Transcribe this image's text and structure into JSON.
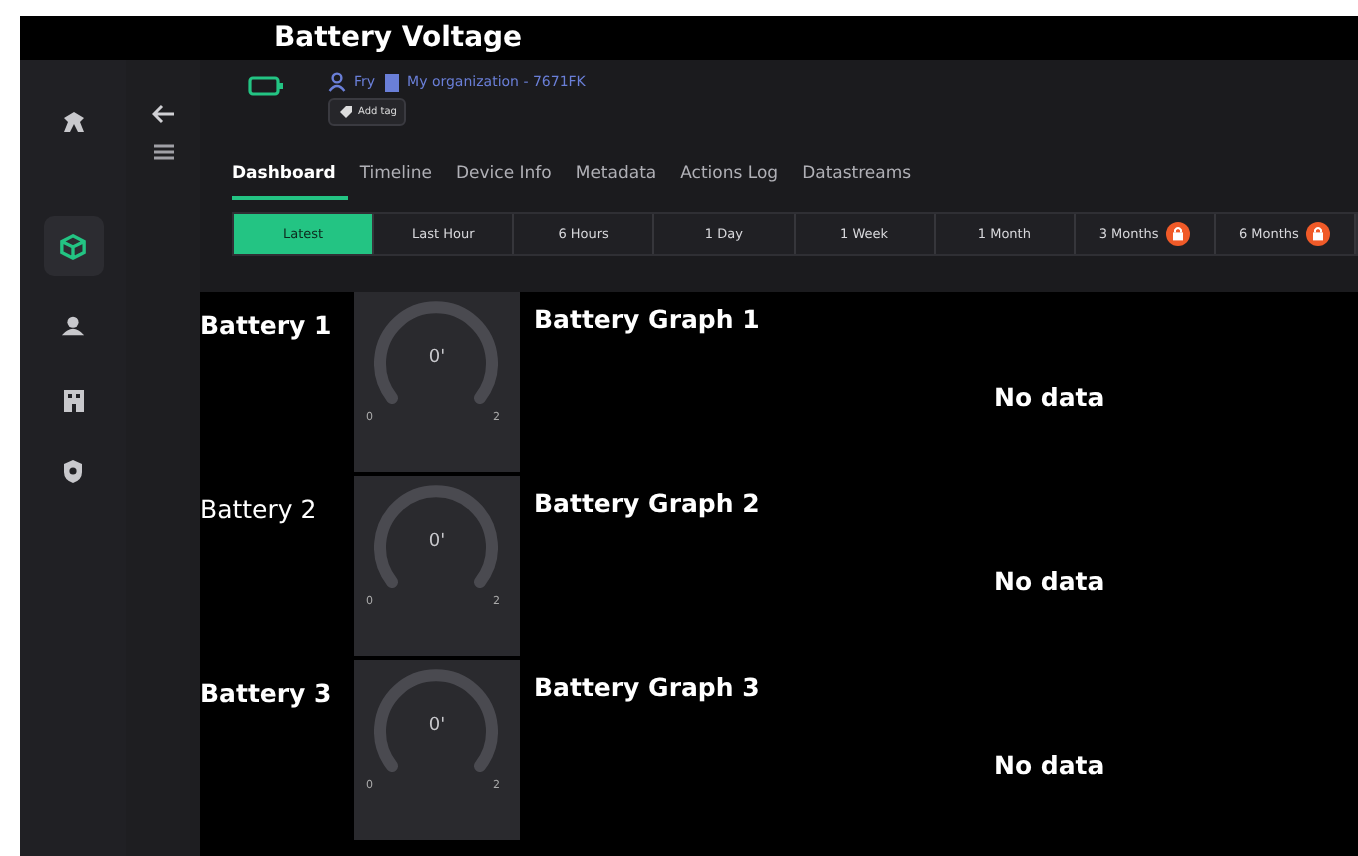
{
  "page_title": "Battery Voltage",
  "rail": [
    {
      "kind": "logo",
      "selected": false
    },
    {
      "kind": "cube",
      "selected": true
    },
    {
      "kind": "users",
      "selected": false
    },
    {
      "kind": "building",
      "selected": false
    },
    {
      "kind": "shield",
      "selected": false
    }
  ],
  "device": {
    "user": "Fry",
    "organization": "My organization - 7671FK",
    "add_tag": "Add tag"
  },
  "tabs": [
    {
      "label": "Dashboard",
      "selected": true
    },
    {
      "label": "Timeline",
      "selected": false
    },
    {
      "label": "Device Info",
      "selected": false
    },
    {
      "label": "Metadata",
      "selected": false
    },
    {
      "label": "Actions Log",
      "selected": false
    },
    {
      "label": "Datastreams",
      "selected": false
    }
  ],
  "ranges": [
    {
      "label": "Latest",
      "selected": true,
      "locked": false
    },
    {
      "label": "Last Hour",
      "selected": false,
      "locked": false
    },
    {
      "label": "6 Hours",
      "selected": false,
      "locked": false
    },
    {
      "label": "1 Day",
      "selected": false,
      "locked": false
    },
    {
      "label": "1 Week",
      "selected": false,
      "locked": false
    },
    {
      "label": "1 Month",
      "selected": false,
      "locked": false
    },
    {
      "label": "3 Months",
      "selected": false,
      "locked": true
    },
    {
      "label": "6 Months",
      "selected": false,
      "locked": true
    }
  ],
  "batteries": [
    {
      "label": "Battery 1",
      "bold": true,
      "gauge": {
        "value": "0'",
        "min": "0",
        "max": "2"
      },
      "graph_title": "Battery Graph 1",
      "graph_message": "No data"
    },
    {
      "label": "Battery 2",
      "bold": false,
      "gauge": {
        "value": "0'",
        "min": "0",
        "max": "2"
      },
      "graph_title": "Battery Graph 2",
      "graph_message": "No data"
    },
    {
      "label": "Battery 3",
      "bold": true,
      "gauge": {
        "value": "0'",
        "min": "0",
        "max": "2"
      },
      "graph_title": "Battery Graph 3",
      "graph_message": "No data"
    }
  ]
}
